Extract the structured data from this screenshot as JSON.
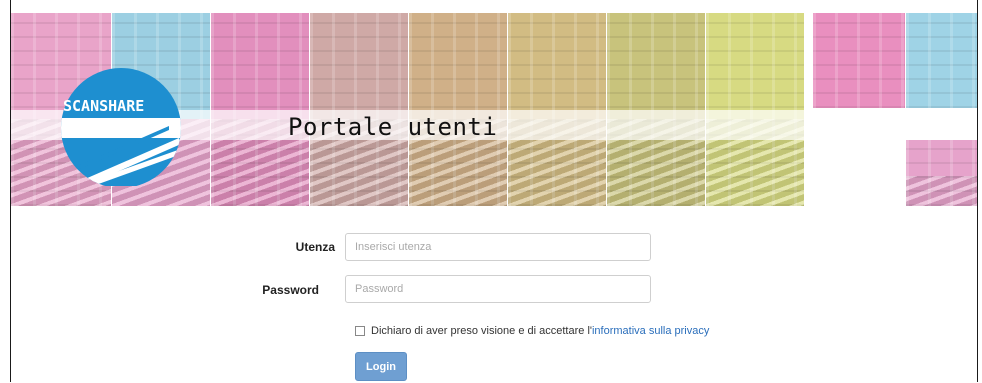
{
  "header": {
    "logo_text": "SCANSHARE",
    "title": "Portale utenti"
  },
  "form": {
    "username": {
      "label": "Utenza",
      "placeholder": "Inserisci utenza",
      "value": ""
    },
    "password": {
      "label": "Password",
      "placeholder": "Password",
      "value": ""
    },
    "privacy": {
      "checked": false,
      "text": "Dichiaro di aver preso visione e di accettare l'",
      "link_text": "informativa sulla privacy"
    },
    "login_label": "Login"
  },
  "colors": {
    "accent": "#2a6ebb",
    "button": "#6f9fd2",
    "logo_blue": "#1e8fd0",
    "tile_magenta": "#e58bbd",
    "tile_cyan": "#7fc7e0",
    "tile_yellow": "#d6d77a"
  }
}
